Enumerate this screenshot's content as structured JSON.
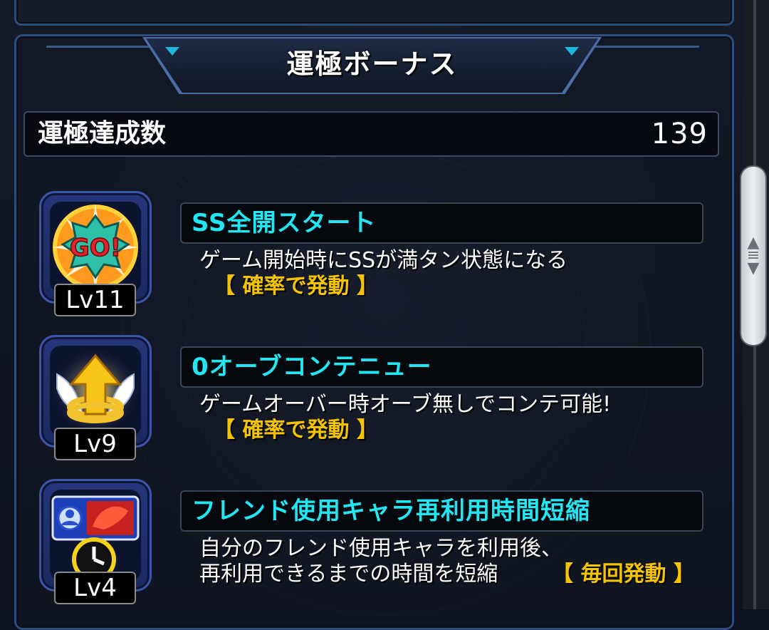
{
  "header": {
    "title": "運極ボーナス"
  },
  "summary": {
    "label": "運極達成数",
    "value": "139"
  },
  "bonuses": [
    {
      "level": "Lv11",
      "icon": "go-burst-icon",
      "icon_text": "GO!",
      "name": "SS全開スタート",
      "desc_lines": [
        "ゲーム開始時にSSが満タン状態になる"
      ],
      "trigger": "【 確率で発動 】"
    },
    {
      "level": "Lv9",
      "icon": "winged-up-arrow-icon",
      "name": "0オーブコンテニュー",
      "desc_lines": [
        "ゲームオーバー時オーブ無しでコンテ可能!"
      ],
      "trigger": "【 確率で発動 】"
    },
    {
      "level": "Lv4",
      "icon": "friend-clock-icon",
      "name": "フレンド使用キャラ再利用時間短縮",
      "desc_lines": [
        "自分のフレンド使用キャラを利用後、",
        "再利用できるまでの時間を短縮"
      ],
      "trigger": "【 毎回発動 】"
    }
  ],
  "colors": {
    "bonus_name": "#22e6f2",
    "trigger": "#f5c400",
    "panel_border": "#2f4e80"
  }
}
